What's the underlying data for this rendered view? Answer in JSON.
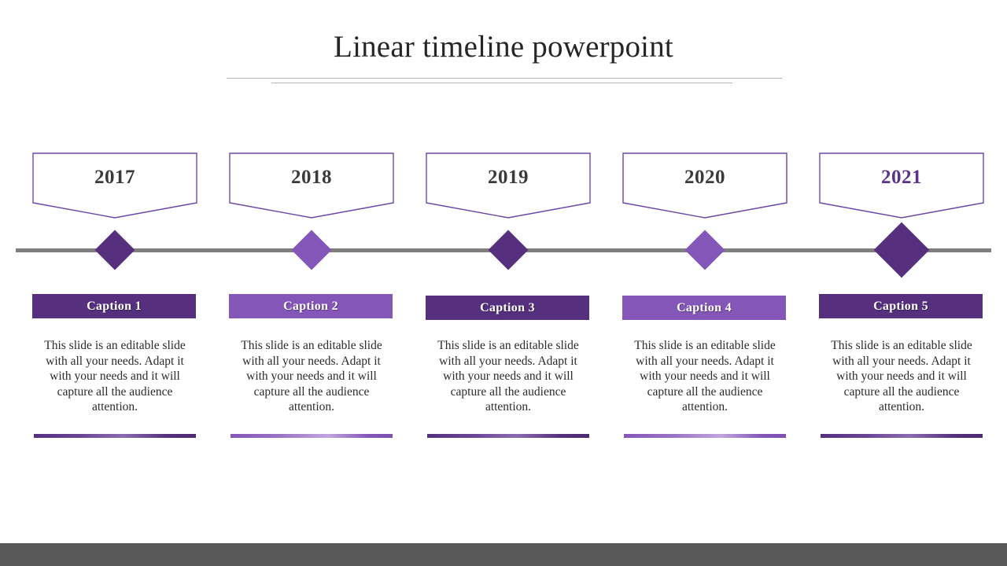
{
  "slide": {
    "title": "Linear timeline powerpoint",
    "background_color": "#ffffff",
    "footer_color": "#595959",
    "axis_color": "#7f7f7f",
    "rule_color": "#b3b3b3",
    "colors": {
      "dark_purple": "#56307f",
      "light_purple": "#8456b8",
      "year_outline": "#6b46a8",
      "year_text": "#3a3a3a",
      "year_text_accent": "#5b3288",
      "caption_text": "#ffffff",
      "body_text": "#2b2b2b"
    }
  },
  "timeline": {
    "items": [
      {
        "year": "2017",
        "year_accent": false,
        "caption": "Caption 1",
        "body": "This slide is an editable slide with all your needs. Adapt it with your needs and it will capture all the audience attention.",
        "bar_color": "#56307f",
        "diamond_color": "#56307f",
        "diamond_size": "small",
        "underline_color": "#56307f"
      },
      {
        "year": "2018",
        "year_accent": false,
        "caption": "Caption 2",
        "body": "This slide is an editable slide with all your needs. Adapt it with your needs and it will capture all the audience attention.",
        "bar_color": "#8456b8",
        "diamond_color": "#8456b8",
        "diamond_size": "small",
        "underline_color": "#8456b8"
      },
      {
        "year": "2019",
        "year_accent": false,
        "caption": "Caption 3",
        "body": "This slide is an editable slide with all your needs. Adapt it with your needs and it will capture all the audience attention.",
        "bar_color": "#56307f",
        "diamond_color": "#56307f",
        "diamond_size": "small",
        "underline_color": "#56307f"
      },
      {
        "year": "2020",
        "year_accent": false,
        "caption": "Caption 4",
        "body": "This slide is an editable slide with all your needs. Adapt it with your needs and it will capture all the audience attention.",
        "bar_color": "#8456b8",
        "diamond_color": "#8456b8",
        "diamond_size": "small",
        "underline_color": "#8456b8"
      },
      {
        "year": "2021",
        "year_accent": true,
        "caption": "Caption 5",
        "body": "This slide is an editable slide with all your needs. Adapt it with your needs and it will capture all the audience attention.",
        "bar_color": "#56307f",
        "diamond_color": "#56307f",
        "diamond_size": "large",
        "underline_color": "#56307f"
      }
    ]
  }
}
